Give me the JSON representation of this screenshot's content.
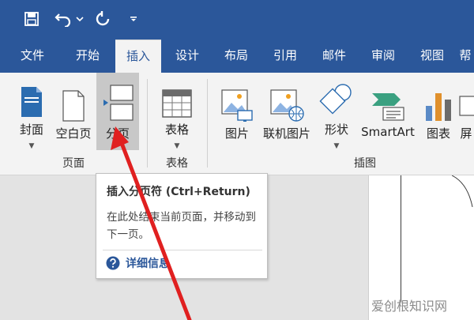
{
  "quick_access": {
    "save_icon": "save-icon",
    "undo_icon": "undo-icon",
    "undo_dropdown_icon": "chevron-down-icon",
    "redo_icon": "repeat-icon",
    "customize_icon": "customize-icon"
  },
  "tabs": [
    {
      "label": "文件",
      "active": false
    },
    {
      "label": "开始",
      "active": false
    },
    {
      "label": "插入",
      "active": true
    },
    {
      "label": "设计",
      "active": false
    },
    {
      "label": "布局",
      "active": false
    },
    {
      "label": "引用",
      "active": false
    },
    {
      "label": "邮件",
      "active": false
    },
    {
      "label": "审阅",
      "active": false
    },
    {
      "label": "视图",
      "active": false
    },
    {
      "label": "帮",
      "active": false
    }
  ],
  "ribbon": {
    "pages_group": {
      "label": "页面",
      "buttons": [
        "封面",
        "空白页",
        "分页"
      ]
    },
    "tables_group": {
      "label": "表格",
      "buttons": [
        "表格"
      ]
    },
    "illustrations_group": {
      "label": "插图",
      "buttons": [
        "图片",
        "联机图片",
        "形状",
        "SmartArt",
        "图表",
        "屏"
      ]
    }
  },
  "tooltip": {
    "title": "插入分页符 (Ctrl+Return)",
    "description": "在此处结束当前页面，并移动到下一页。",
    "more_info": "详细信息"
  },
  "watermark": "爱创根知识网",
  "colors": {
    "brand": "#2b579a",
    "ribbon_bg": "#f3f3f3",
    "arrow": "#e02020"
  }
}
